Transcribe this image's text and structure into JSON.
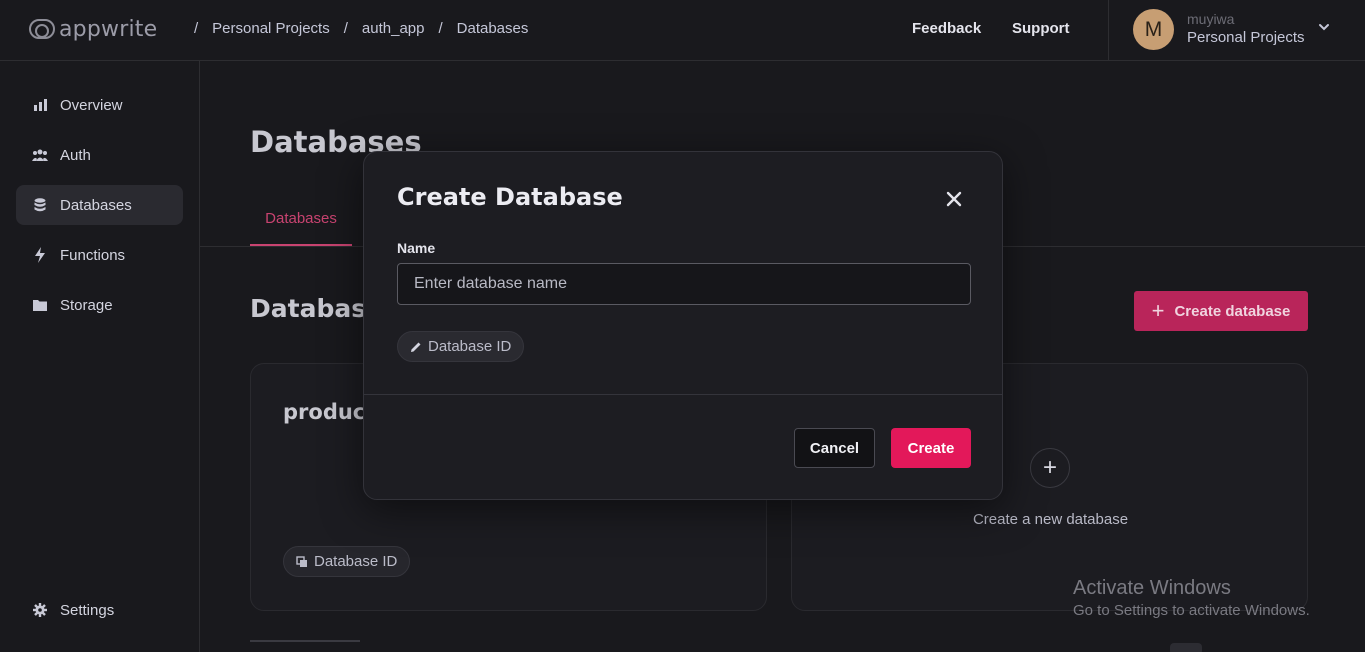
{
  "header": {
    "logo_text": "appwrite",
    "breadcrumbs": [
      "Personal Projects",
      "auth_app",
      "Databases"
    ],
    "breadcrumb_separator": "/",
    "feedback": "Feedback",
    "support": "Support",
    "avatar_initial": "M",
    "user_name": "muyiwa",
    "project_name": "Personal Projects"
  },
  "sidebar": {
    "items": [
      {
        "label": "Overview",
        "icon": "bar-chart-icon"
      },
      {
        "label": "Auth",
        "icon": "users-icon"
      },
      {
        "label": "Databases",
        "icon": "database-icon",
        "active": true
      },
      {
        "label": "Functions",
        "icon": "lightning-icon"
      },
      {
        "label": "Storage",
        "icon": "folder-icon"
      }
    ],
    "settings": "Settings"
  },
  "main": {
    "title": "Databases",
    "tab": "Databases",
    "section_title": "Databases",
    "create_button": "Create database",
    "cards": [
      {
        "title": "product",
        "id_label": "Database ID"
      }
    ],
    "new_card_label": "Create a new database"
  },
  "modal": {
    "title": "Create Database",
    "name_label": "Name",
    "name_placeholder": "Enter database name",
    "name_value": "",
    "id_pill": "Database ID",
    "cancel": "Cancel",
    "create": "Create"
  },
  "watermark": {
    "title": "Activate Windows",
    "subtitle": "Go to Settings to activate Windows."
  },
  "colors": {
    "accent": "#e3185a",
    "accent_dim": "#b9255a",
    "background": "#19191d"
  }
}
